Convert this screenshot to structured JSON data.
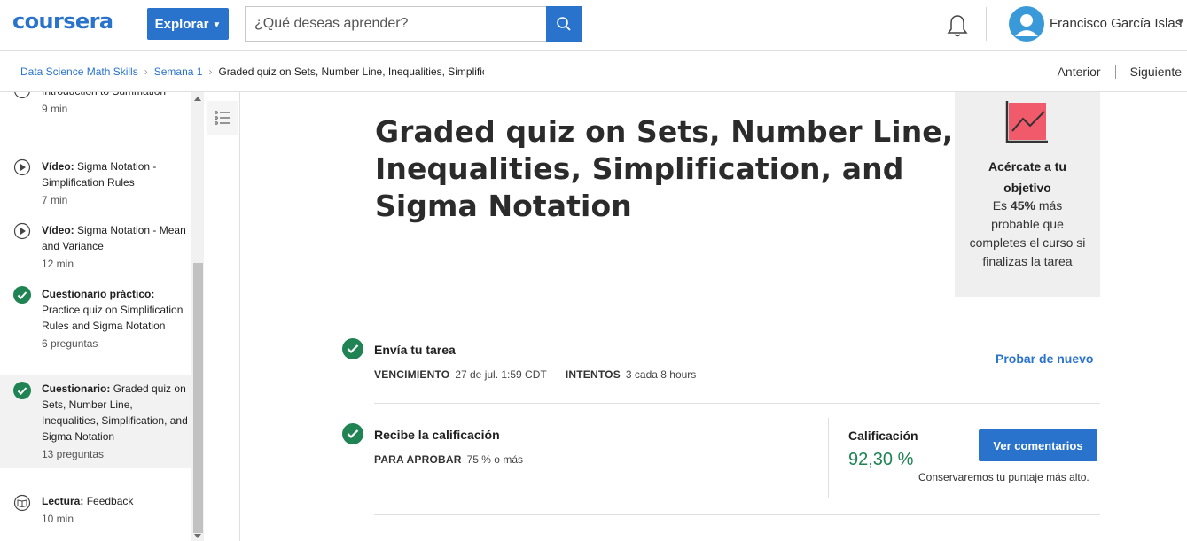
{
  "header": {
    "logo": "coursera",
    "explore_label": "Explorar",
    "search_placeholder": "¿Qué deseas aprender?",
    "user_name": "Francisco García Islas"
  },
  "breadcrumb": {
    "items": [
      "Data Science Math Skills",
      "Semana 1"
    ],
    "current": "Graded quiz on Sets, Number Line, Inequalities, Simplification, and Sigma Notation",
    "prev_label": "Anterior",
    "next_label": "Siguiente"
  },
  "sidebar": {
    "items": [
      {
        "type": "video",
        "kind": "",
        "title": "Introduction to Summation",
        "meta": "9 min",
        "partial": true
      },
      {
        "type": "video",
        "kind": "Vídeo:",
        "title": "Sigma Notation - Simplification Rules",
        "meta": "7 min"
      },
      {
        "type": "video",
        "kind": "Vídeo:",
        "title": "Sigma Notation - Mean and Variance",
        "meta": "12 min"
      },
      {
        "type": "done",
        "kind": "Cuestionario práctico:",
        "title": "Practice quiz on Simplification Rules and Sigma Notation",
        "meta": "6 preguntas"
      },
      {
        "type": "done",
        "kind": "Cuestionario:",
        "title": "Graded quiz on Sets, Number Line, Inequalities, Simplification, and Sigma Notation",
        "meta": "13 preguntas",
        "active": true
      },
      {
        "type": "reading",
        "kind": "Lectura:",
        "title": "Feedback",
        "meta": "10 min"
      }
    ]
  },
  "main": {
    "title": "Graded quiz on Sets, Number Line, Inequalities, Simplification, and Sigma Notation",
    "submit": {
      "title": "Envía tu tarea",
      "due_label": "VENCIMIENTO",
      "due_value": "27 de jul. 1:59 CDT",
      "attempts_label": "INTENTOS",
      "attempts_value": "3 cada 8 hours",
      "retry_label": "Probar de nuevo"
    },
    "grade": {
      "title": "Recibe la calificación",
      "pass_label": "PARA APROBAR",
      "pass_value": "75 % o más",
      "grade_label": "Calificación",
      "grade_value": "92,30 %",
      "feedback_label": "Ver comentarios",
      "keep_note": "Conservaremos tu puntaje más alto."
    }
  },
  "goal": {
    "title": "Acércate a tu objetivo",
    "body_prefix": "Es ",
    "percent": "45%",
    "body_suffix": " más probable que completes el curso si finalizas la tarea"
  },
  "colors": {
    "accent": "#2a73cc",
    "success": "#1f8354",
    "goal_chart": "#f05a6a"
  }
}
